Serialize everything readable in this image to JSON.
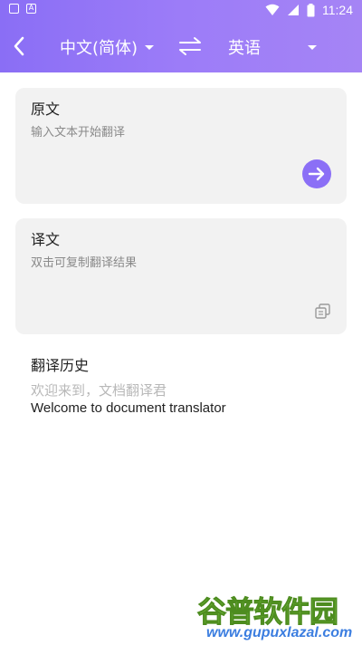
{
  "status_bar": {
    "time": "11:24"
  },
  "toolbar": {
    "source_language": "中文(简体)",
    "target_language": "英语"
  },
  "source_card": {
    "title": "原文",
    "placeholder": "输入文本开始翻译"
  },
  "result_card": {
    "title": "译文",
    "hint": "双击可复制翻译结果"
  },
  "history": {
    "title": "翻译历史",
    "welcome": "欢迎来到，文档翻译君",
    "welcome_en": "Welcome to document translator"
  },
  "watermark": {
    "brand": "谷普软件园",
    "url": "www.gupuxlazal.com"
  },
  "colors": {
    "accent": "#8b6ff6",
    "card_bg": "#f2f2f2"
  }
}
